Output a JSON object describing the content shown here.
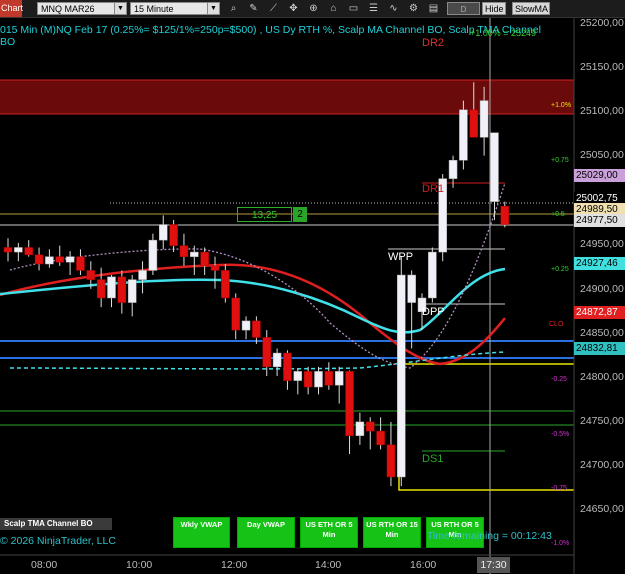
{
  "toolbar": {
    "app_tab": "Chart",
    "instrument": "MNQ MAR26",
    "interval": "15 Minute",
    "btn_dvwap": "D VWAP",
    "btn_hide": "Hide",
    "btn_slowma": "SlowMA"
  },
  "info_line1": "015 Min (M)NQ Feb 17  (0.25%= $125/1%=250p=$500) , US Dy RTH %, Scalp MA Channel BO, Scalp TMA Channel",
  "info_line2": "BO",
  "mtext": "+1.00% = 25249",
  "labels": {
    "dr2": "DR2",
    "dr1": "DR1",
    "wpp": "WPP",
    "dpp": "DPP",
    "ds1": "DS1",
    "clos": "CLO"
  },
  "pct_labels": {
    "p100": "+1.0%",
    "p075": "+0.75",
    "p050": "+0.5",
    "p025": "+0.25",
    "m025": "-0.25",
    "m050": "-0.5%",
    "m075": "-0.75",
    "m100": "-1.0%"
  },
  "position": {
    "price": "13,25",
    "qty": "2"
  },
  "price_axis": [
    "25200,00",
    "25150,00",
    "25100,00",
    "25050,00",
    "24950,00",
    "24900,00",
    "24850,00",
    "24800,00",
    "24750,00",
    "24700,00",
    "24650,00"
  ],
  "price_tags": [
    {
      "text": "25029,00",
      "bg": "#c9a0d9"
    },
    {
      "text": "25002,75",
      "bg": "#000000"
    },
    {
      "text": "24989,50",
      "bg": "#f0e0b0"
    },
    {
      "text": "24977,50",
      "bg": "#e0e0e0"
    },
    {
      "text": "24927,46",
      "bg": "#40e0e0"
    },
    {
      "text": "24872,87",
      "bg": "#e02020"
    },
    {
      "text": "24832,81",
      "bg": "#30c0c0"
    }
  ],
  "time_axis": [
    "08:00",
    "10:00",
    "12:00",
    "14:00",
    "16:00"
  ],
  "current_time": "17:30",
  "buttons": [
    {
      "label": "Wkly VWAP"
    },
    {
      "label": "Day VWAP"
    },
    {
      "label": "US ETH OR 5 Min"
    },
    {
      "label": "US RTH OR 15 Min"
    },
    {
      "label": "US RTH OR 5 Min"
    }
  ],
  "scalp_label": "Scalp TMA Channel BO",
  "copyright": "© 2026 NinjaTrader, LLC",
  "time_remaining": "Time remaining = 00:12:43",
  "chart_data": {
    "type": "candlestick",
    "ylim": [
      24625,
      25210
    ],
    "candles": [
      {
        "o": 24960,
        "h": 24970,
        "l": 24945,
        "c": 24955
      },
      {
        "o": 24955,
        "h": 24965,
        "l": 24945,
        "c": 24960
      },
      {
        "o": 24960,
        "h": 24968,
        "l": 24950,
        "c": 24952
      },
      {
        "o": 24952,
        "h": 24960,
        "l": 24935,
        "c": 24942
      },
      {
        "o": 24942,
        "h": 24958,
        "l": 24938,
        "c": 24950
      },
      {
        "o": 24950,
        "h": 24962,
        "l": 24940,
        "c": 24944
      },
      {
        "o": 24944,
        "h": 24956,
        "l": 24930,
        "c": 24950
      },
      {
        "o": 24950,
        "h": 24958,
        "l": 24930,
        "c": 24935
      },
      {
        "o": 24935,
        "h": 24945,
        "l": 24915,
        "c": 24925
      },
      {
        "o": 24925,
        "h": 24938,
        "l": 24895,
        "c": 24905
      },
      {
        "o": 24905,
        "h": 24930,
        "l": 24895,
        "c": 24928
      },
      {
        "o": 24928,
        "h": 24935,
        "l": 24888,
        "c": 24900
      },
      {
        "o": 24900,
        "h": 24930,
        "l": 24885,
        "c": 24925
      },
      {
        "o": 24925,
        "h": 24945,
        "l": 24910,
        "c": 24935
      },
      {
        "o": 24935,
        "h": 24975,
        "l": 24930,
        "c": 24968
      },
      {
        "o": 24968,
        "h": 24995,
        "l": 24958,
        "c": 24985
      },
      {
        "o": 24985,
        "h": 24990,
        "l": 24955,
        "c": 24962
      },
      {
        "o": 24962,
        "h": 24975,
        "l": 24940,
        "c": 24950
      },
      {
        "o": 24950,
        "h": 24962,
        "l": 24930,
        "c": 24955
      },
      {
        "o": 24955,
        "h": 24960,
        "l": 24930,
        "c": 24940
      },
      {
        "o": 24940,
        "h": 24950,
        "l": 24915,
        "c": 24935
      },
      {
        "o": 24935,
        "h": 24942,
        "l": 24900,
        "c": 24905
      },
      {
        "o": 24905,
        "h": 24910,
        "l": 24860,
        "c": 24870
      },
      {
        "o": 24870,
        "h": 24885,
        "l": 24860,
        "c": 24880
      },
      {
        "o": 24880,
        "h": 24885,
        "l": 24855,
        "c": 24862
      },
      {
        "o": 24862,
        "h": 24870,
        "l": 24820,
        "c": 24830
      },
      {
        "o": 24830,
        "h": 24850,
        "l": 24820,
        "c": 24845
      },
      {
        "o": 24845,
        "h": 24848,
        "l": 24805,
        "c": 24815
      },
      {
        "o": 24815,
        "h": 24828,
        "l": 24800,
        "c": 24825
      },
      {
        "o": 24825,
        "h": 24830,
        "l": 24800,
        "c": 24808
      },
      {
        "o": 24808,
        "h": 24830,
        "l": 24800,
        "c": 24825
      },
      {
        "o": 24825,
        "h": 24835,
        "l": 24805,
        "c": 24810
      },
      {
        "o": 24810,
        "h": 24830,
        "l": 24790,
        "c": 24825
      },
      {
        "o": 24825,
        "h": 24826,
        "l": 24735,
        "c": 24755
      },
      {
        "o": 24755,
        "h": 24780,
        "l": 24745,
        "c": 24770
      },
      {
        "o": 24770,
        "h": 24775,
        "l": 24740,
        "c": 24760
      },
      {
        "o": 24760,
        "h": 24775,
        "l": 24740,
        "c": 24745
      },
      {
        "o": 24745,
        "h": 24770,
        "l": 24700,
        "c": 24710
      },
      {
        "o": 24710,
        "h": 24950,
        "l": 24700,
        "c": 24930
      },
      {
        "o": 24900,
        "h": 24935,
        "l": 24850,
        "c": 24930
      },
      {
        "o": 24890,
        "h": 24910,
        "l": 24870,
        "c": 24905
      },
      {
        "o": 24905,
        "h": 24960,
        "l": 24900,
        "c": 24955
      },
      {
        "o": 24955,
        "h": 25040,
        "l": 24945,
        "c": 25035
      },
      {
        "o": 25035,
        "h": 25060,
        "l": 25025,
        "c": 25055
      },
      {
        "o": 25055,
        "h": 25120,
        "l": 25045,
        "c": 25110
      },
      {
        "o": 25110,
        "h": 25140,
        "l": 25090,
        "c": 25080
      },
      {
        "o": 25080,
        "h": 25135,
        "l": 25060,
        "c": 25120
      },
      {
        "o": 25010,
        "h": 25085,
        "l": 24990,
        "c": 25085
      },
      {
        "o": 25005,
        "h": 25010,
        "l": 24982,
        "c": 24985
      }
    ]
  }
}
